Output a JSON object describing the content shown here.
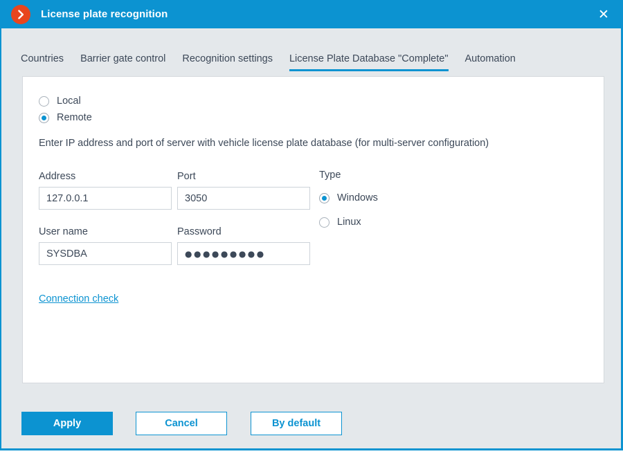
{
  "window": {
    "title": "License plate recognition",
    "logo_icon": "chevron-right-circle-icon",
    "close_icon": "✕"
  },
  "tabs": [
    {
      "label": "Countries",
      "active": false
    },
    {
      "label": "Barrier gate control",
      "active": false
    },
    {
      "label": "Recognition settings",
      "active": false
    },
    {
      "label": "License Plate Database \"Complete\"",
      "active": true
    },
    {
      "label": "Automation",
      "active": false
    }
  ],
  "panel": {
    "mode_options": [
      {
        "label": "Local",
        "selected": false
      },
      {
        "label": "Remote",
        "selected": true
      }
    ],
    "description": "Enter IP address and port of server with vehicle license plate database (for multi-server configuration)",
    "fields": {
      "address": {
        "label": "Address",
        "value": "127.0.0.1"
      },
      "port": {
        "label": "Port",
        "value": "3050"
      },
      "username": {
        "label": "User name",
        "value": "SYSDBA"
      },
      "password": {
        "label": "Password",
        "value": "●●●●●●●●●"
      }
    },
    "type": {
      "label": "Type",
      "options": [
        {
          "label": "Windows",
          "selected": true
        },
        {
          "label": "Linux",
          "selected": false
        }
      ]
    },
    "connection_check_link": "Connection check"
  },
  "footer": {
    "apply": "Apply",
    "cancel": "Cancel",
    "by_default": "By default"
  },
  "colors": {
    "accent": "#0c93d1",
    "logo": "#e8461e",
    "dialog_bg": "#e4e8eb",
    "panel_bg": "#ffffff",
    "text": "#3c4858"
  }
}
